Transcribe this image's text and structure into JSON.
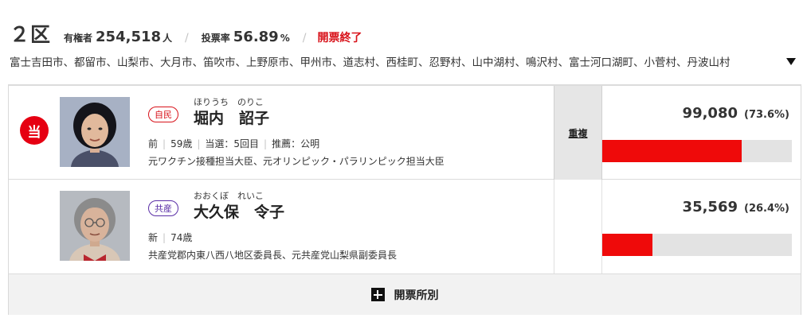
{
  "header": {
    "district": "２区",
    "electorate_label": "有権者",
    "electorate_value": "254,518",
    "electorate_unit": "人",
    "turnout_label": "投票率",
    "turnout_value": "56.89",
    "turnout_unit": "%",
    "status": "開票終了"
  },
  "areas": {
    "text": "富士吉田市、都留市、山梨市、大月市、笛吹市、上野原市、甲州市、道志村、西桂町、忍野村、山中湖村、鳴沢村、富士河口湖町、小菅村、丹波山村"
  },
  "candidates": [
    {
      "elected_badge": "当",
      "photo": "portrait-woman-short-black-hair",
      "party": "自民",
      "furigana": "ほりうち　のりこ",
      "name": "堀内　詔子",
      "status": "前",
      "age": "59歳",
      "terms": "当選：5回目",
      "endorsement": "推薦：公明",
      "career": "元ワクチン接種担当大臣、元オリンピック・パラリンピック担当大臣",
      "dual_candidacy": "重複",
      "votes": "99,080",
      "pct": "(73.6%)",
      "share": 0.736
    },
    {
      "elected_badge": "",
      "photo": "portrait-woman-gray-hair-glasses",
      "party": "共産",
      "furigana": "おおくぼ　れいこ",
      "name": "大久保　令子",
      "status": "新",
      "age": "74歳",
      "career": "共産党郡内東八西八地区委員長、元共産党山梨県副委員長",
      "dual_candidacy": "",
      "votes": "35,569",
      "pct": "(26.4%)",
      "share": 0.264
    }
  ],
  "more_button": {
    "label": "開票所別",
    "icon": "plus-square-icon"
  },
  "colors": {
    "accent_red": "#e60012",
    "bar_red": "#ef0a0a",
    "bar_bg": "#e3e3e3",
    "ldp": "#d8121a",
    "jcp": "#5a2ea6"
  }
}
